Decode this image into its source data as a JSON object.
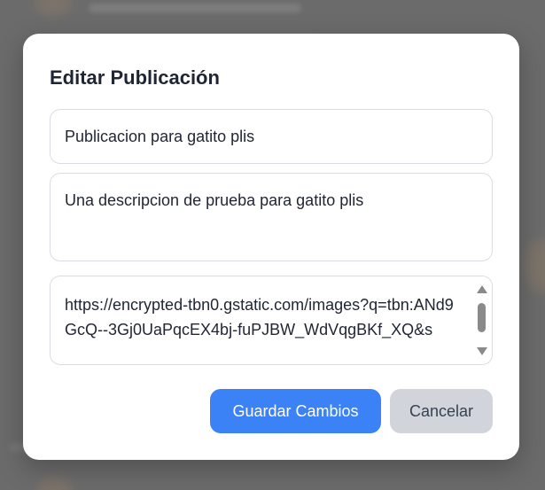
{
  "modal": {
    "title": "Editar Publicación",
    "title_field_value": "Publicacion para gatito plis",
    "description_field_value": "Una descripcion de prueba para gatito plis",
    "image_url_field_value": "https://encrypted-tbn0.gstatic.com/images?q=tbn:ANd9GcQ--3Gj0UaPqcEX4bj-fuPJBW_WdVqgBKf_XQ&s",
    "save_label": "Guardar Cambios",
    "cancel_label": "Cancelar"
  },
  "colors": {
    "save_button_bg": "#3b82f6",
    "cancel_button_bg": "#d1d5db",
    "overlay": "#6b6b6b"
  }
}
